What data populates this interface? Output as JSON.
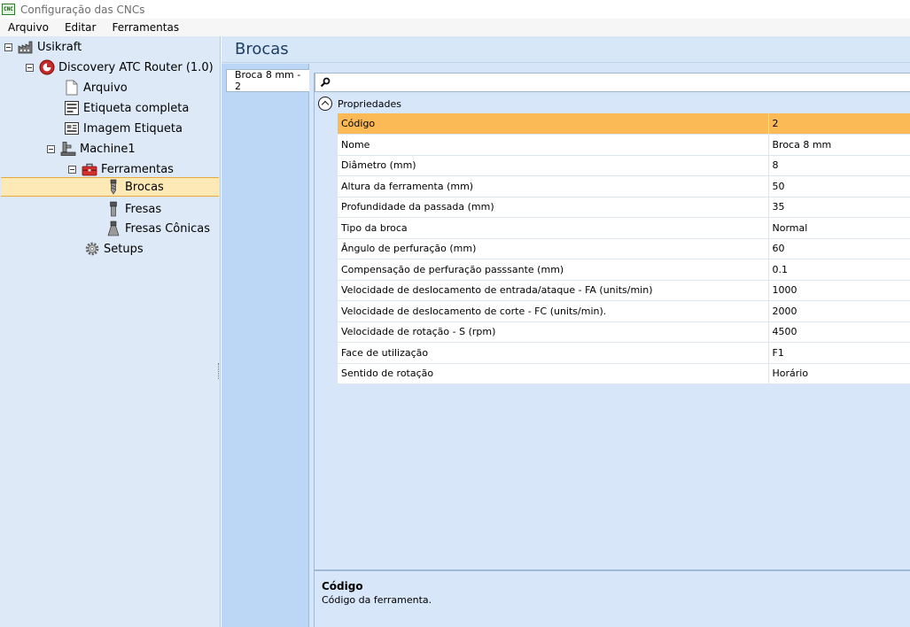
{
  "window": {
    "title": "Configuração das CNCs",
    "app_icon_text": "CNC"
  },
  "menu": [
    "Arquivo",
    "Editar",
    "Ferramentas"
  ],
  "tree": {
    "root": "Usikraft",
    "machine": "Discovery ATC Router (1.0)",
    "arquivo": "Arquivo",
    "etiqueta_completa": "Etiqueta completa",
    "imagem_etiqueta": "Imagem Etiqueta",
    "machine1": "Machine1",
    "ferramentas": "Ferramentas",
    "brocas": "Brocas",
    "fresas": "Fresas",
    "fresas_conicas": "Fresas Cônicas",
    "setups": "Setups"
  },
  "header": {
    "title": "Brocas"
  },
  "tabs": [
    {
      "label": "Broca 8 mm - 2"
    }
  ],
  "search": {
    "value": "",
    "placeholder": ""
  },
  "property_grid": {
    "category": "Propriedades",
    "rows": [
      {
        "name": "Código",
        "value": "2",
        "selected": true
      },
      {
        "name": "Nome",
        "value": "Broca 8 mm"
      },
      {
        "name": "Diâmetro (mm)",
        "value": "8"
      },
      {
        "name": "Altura da ferramenta (mm)",
        "value": "50"
      },
      {
        "name": "Profundidade da passada (mm)",
        "value": "35"
      },
      {
        "name": "Tipo da broca",
        "value": "Normal"
      },
      {
        "name": "Ângulo de perfuração (mm)",
        "value": "60"
      },
      {
        "name": "Compensação de perfuração passsante (mm)",
        "value": "0.1"
      },
      {
        "name": "Velocidade de deslocamento de entrada/ataque - FA (units/min)",
        "value": "1000"
      },
      {
        "name": "Velocidade de deslocamento de corte - FC (units/min).",
        "value": "2000"
      },
      {
        "name": "Velocidade de rotação - S (rpm)",
        "value": "4500"
      },
      {
        "name": "Face de utilização",
        "value": "F1"
      },
      {
        "name": "Sentido de rotação",
        "value": "Horário"
      }
    ]
  },
  "description": {
    "title": "Código",
    "text": "Código da ferramenta."
  },
  "colors": {
    "tree_background": "#dde9f7",
    "selection_fill": "#fde9b5",
    "selection_border": "#e8a93b",
    "grid_selected_row": "#fbba55",
    "tab_strip": "#bcd7f5"
  }
}
